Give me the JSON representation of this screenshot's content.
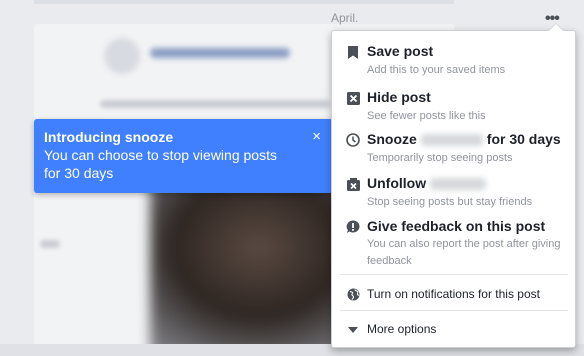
{
  "post_header": {
    "date_text": "April.",
    "more_icon": "ellipsis-icon"
  },
  "tooltip": {
    "title": "Introducing snooze",
    "body": "You can choose to stop viewing posts for 30 days",
    "close_label": "×"
  },
  "menu": {
    "items": [
      {
        "icon": "bookmark-icon",
        "title": "Save post",
        "subtitle": "Add this to your saved items"
      },
      {
        "icon": "hide-icon",
        "title": "Hide post",
        "subtitle": "See fewer posts like this"
      },
      {
        "icon": "clock-icon",
        "title_prefix": "Snooze",
        "title_suffix": "for 30 days",
        "subtitle": "Temporarily stop seeing posts"
      },
      {
        "icon": "unfollow-icon",
        "title_prefix": "Unfollow",
        "subtitle": "Stop seeing posts but stay friends"
      },
      {
        "icon": "feedback-icon",
        "title": "Give feedback on this post",
        "subtitle": "You can also report the post after giving feedback"
      }
    ],
    "notifications_label": "Turn on notifications for this post",
    "more_options_label": "More options"
  }
}
